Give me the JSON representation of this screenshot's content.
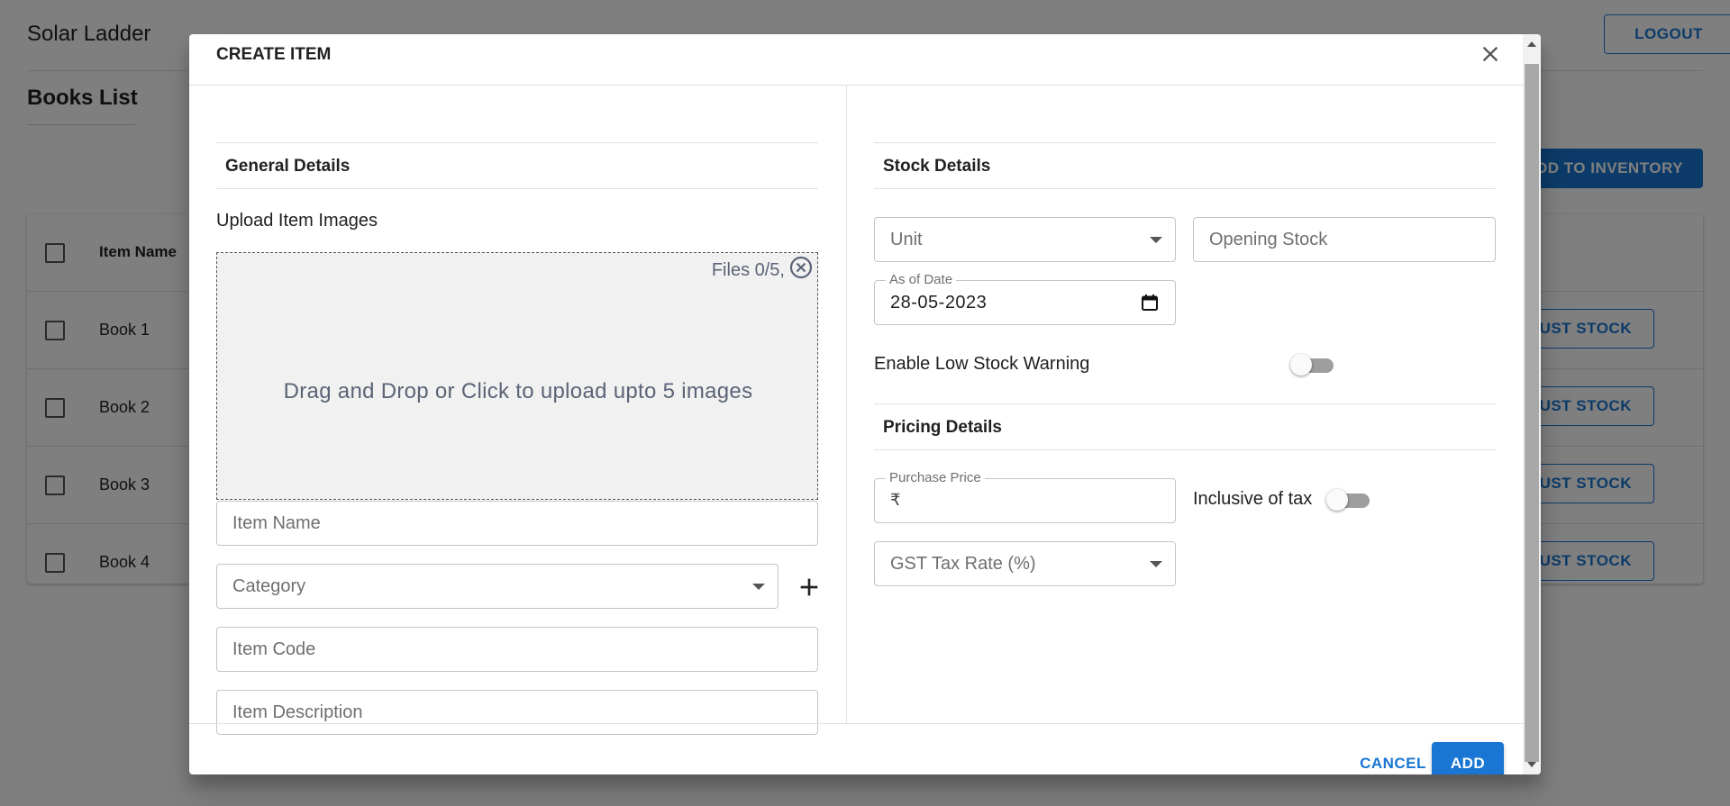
{
  "app": {
    "title": "Solar Ladder",
    "logout_label": "LOGOUT"
  },
  "page": {
    "title": "Books List",
    "add_to_inventory_label": "ADD TO INVENTORY"
  },
  "table": {
    "column_item_name": "Item Name",
    "rows": [
      {
        "name": "Book 1",
        "action": "ADJUST STOCK"
      },
      {
        "name": "Book 2",
        "action": "ADJUST STOCK"
      },
      {
        "name": "Book 3",
        "action": "ADJUST STOCK"
      },
      {
        "name": "Book 4",
        "action": "ADJUST STOCK"
      }
    ]
  },
  "dialog": {
    "title": "CREATE ITEM",
    "general": {
      "heading": "General Details",
      "upload_label": "Upload Item Images",
      "files_count": "Files 0/5,",
      "drop_text": "Drag and Drop or Click to upload upto 5 images",
      "item_name_placeholder": "Item Name",
      "category_placeholder": "Category",
      "item_code_placeholder": "Item Code",
      "item_description_placeholder": "Item Description"
    },
    "stock": {
      "heading": "Stock Details",
      "unit_placeholder": "Unit",
      "opening_stock_placeholder": "Opening Stock",
      "as_of_date_label": "As of Date",
      "as_of_date_value": "28-05-2023",
      "low_stock_label": "Enable Low Stock Warning",
      "low_stock_enabled": false
    },
    "pricing": {
      "heading": "Pricing Details",
      "purchase_price_label": "Purchase Price",
      "currency_symbol": "₹",
      "inclusive_tax_label": "Inclusive of tax",
      "inclusive_tax_enabled": false,
      "gst_placeholder": "GST Tax Rate (%)"
    },
    "actions": {
      "cancel_label": "CANCEL",
      "add_label": "ADD"
    }
  },
  "colors": {
    "primary": "#1976d2",
    "backdrop": "rgba(0,0,0,0.5)",
    "dropzone_bg": "#f1f1f1"
  },
  "icons": [
    "close-icon",
    "clear-icon",
    "plus-icon",
    "calendar-icon",
    "dropdown-caret-icon"
  ]
}
